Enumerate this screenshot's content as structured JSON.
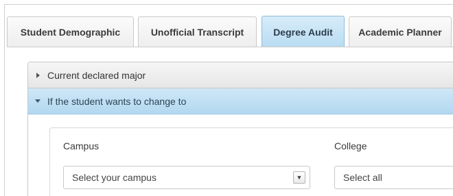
{
  "tabs": [
    {
      "label": "Student Demographic",
      "active": false
    },
    {
      "label": "Unofficial Transcript",
      "active": false
    },
    {
      "label": "Degree Audit",
      "active": true
    },
    {
      "label": "Academic Planner",
      "active": false
    }
  ],
  "accordion": {
    "current_major": {
      "label": "Current declared major",
      "icon": "caret-right-icon"
    },
    "change_to": {
      "label": "If the student wants to change to",
      "icon": "caret-down-icon"
    }
  },
  "form": {
    "campus": {
      "label": "Campus",
      "value": "Select your campus",
      "icon": "chevron-down-icon"
    },
    "college": {
      "label": "College",
      "value": "Select all"
    }
  },
  "colors": {
    "active_tab": "#b8dcf2",
    "open_header": "#b2d8f0"
  }
}
